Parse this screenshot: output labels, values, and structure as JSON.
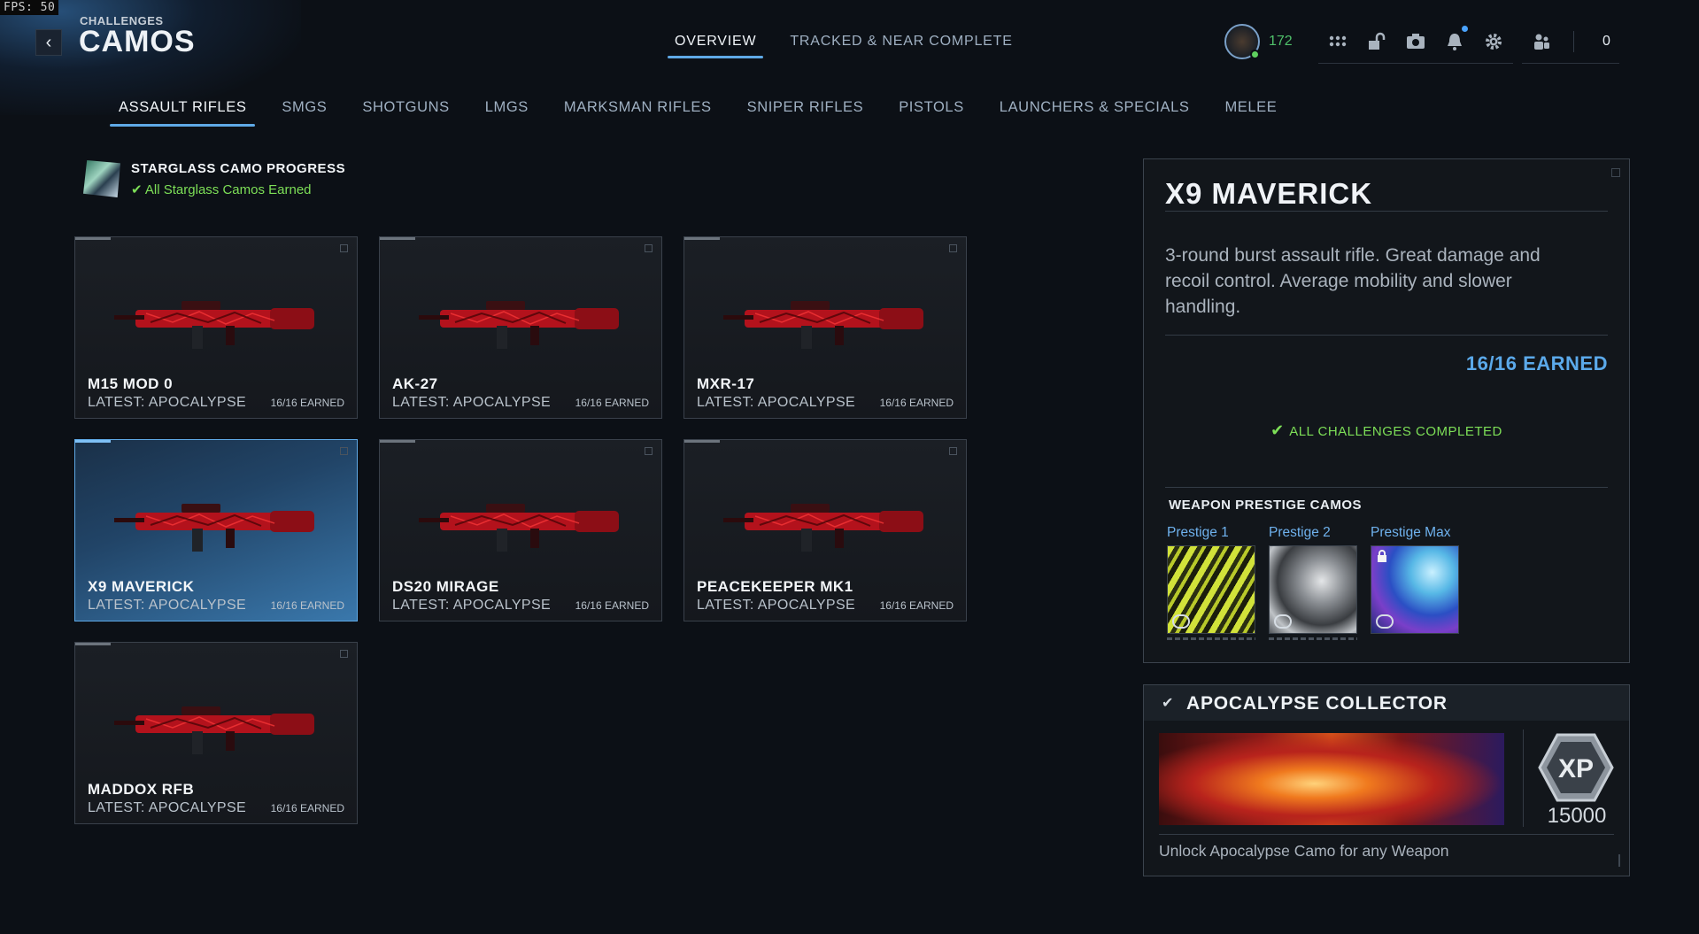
{
  "fps": "FPS:  50",
  "header": {
    "breadcrumb": "CHALLENGES",
    "title": "CAMOS",
    "tabs": [
      {
        "label": "OVERVIEW",
        "active": true
      },
      {
        "label": "TRACKED & NEAR COMPLETE",
        "active": false
      }
    ],
    "player_level": "172",
    "party_count": "0",
    "icons": [
      "avatar-icon",
      "grid-menu-icon",
      "unlock-icon",
      "camera-icon",
      "bell-icon",
      "gear-icon",
      "party-icon"
    ]
  },
  "categories": [
    {
      "label": "ASSAULT RIFLES",
      "active": true
    },
    {
      "label": "SMGS"
    },
    {
      "label": "SHOTGUNS"
    },
    {
      "label": "LMGS"
    },
    {
      "label": "MARKSMAN RIFLES"
    },
    {
      "label": "SNIPER RIFLES"
    },
    {
      "label": "PISTOLS"
    },
    {
      "label": "LAUNCHERS & SPECIALS"
    },
    {
      "label": "MELEE"
    }
  ],
  "starglass": {
    "title": "STARGLASS CAMO PROGRESS",
    "status": "All Starglass Camos Earned"
  },
  "weapons": [
    {
      "name": "M15 MOD 0",
      "latest": "LATEST: APOCALYPSE",
      "earned": "16/16 EARNED"
    },
    {
      "name": "AK-27",
      "latest": "LATEST: APOCALYPSE",
      "earned": "16/16 EARNED"
    },
    {
      "name": "MXR-17",
      "latest": "LATEST: APOCALYPSE",
      "earned": "16/16 EARNED"
    },
    {
      "name": "X9 MAVERICK",
      "latest": "LATEST: APOCALYPSE",
      "earned": "16/16 EARNED",
      "selected": true
    },
    {
      "name": "DS20 MIRAGE",
      "latest": "LATEST: APOCALYPSE",
      "earned": "16/16 EARNED"
    },
    {
      "name": "PEACEKEEPER MK1",
      "latest": "LATEST: APOCALYPSE",
      "earned": "16/16 EARNED"
    },
    {
      "name": "MADDOX RFB",
      "latest": "LATEST: APOCALYPSE",
      "earned": "16/16 EARNED"
    }
  ],
  "detail": {
    "name": "X9 MAVERICK",
    "description": "3-round burst assault rifle. Great damage and recoil control. Average mobility and slower handling.",
    "earned": "16/16 EARNED",
    "completed": "ALL CHALLENGES COMPLETED",
    "prestige_heading": "WEAPON PRESTIGE CAMOS",
    "prestige": [
      {
        "label": "Prestige 1",
        "locked": false
      },
      {
        "label": "Prestige 2",
        "locked": false
      },
      {
        "label": "Prestige Max",
        "locked": true
      }
    ]
  },
  "challenge": {
    "title": "APOCALYPSE COLLECTOR",
    "xp_label": "XP",
    "xp_amount": "15000",
    "description": "Unlock Apocalypse Camo for any Weapon"
  },
  "colors": {
    "accent_blue": "#5fa9e6",
    "success_green": "#7ddf57",
    "camo_red": "#b3121c",
    "background": "#0c1016"
  }
}
